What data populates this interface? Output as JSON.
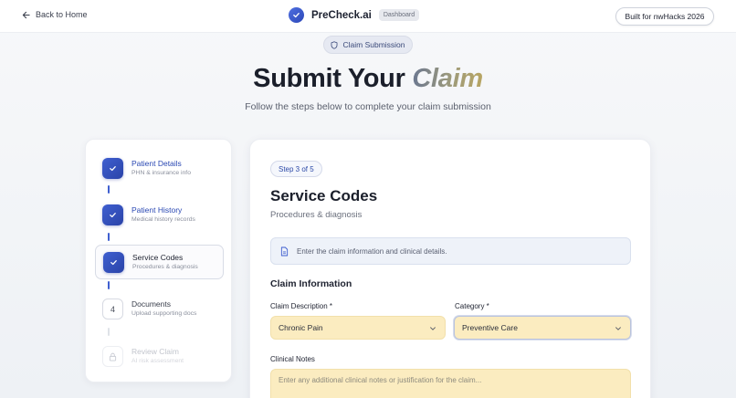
{
  "nav": {
    "back_label": "Back to Home",
    "brand_name": "PreCheck.ai",
    "brand_badge": "Dashboard",
    "built_label": "Built for nwHacks 2026"
  },
  "hero": {
    "pill_label": "Claim Submission",
    "title_main": "Submit Your ",
    "title_accent": "Claim",
    "subtitle": "Follow the steps below to complete your claim submission"
  },
  "steps": [
    {
      "title": "Patient Details",
      "desc": "PHN & insurance info",
      "status": "done"
    },
    {
      "title": "Patient History",
      "desc": "Medical history records",
      "status": "done"
    },
    {
      "title": "Service Codes",
      "desc": "Procedures & diagnosis",
      "status": "active"
    },
    {
      "title": "Documents",
      "desc": "Upload supporting docs",
      "status": "pending",
      "number": "4"
    },
    {
      "title": "Review Claim",
      "desc": "AI risk assessment",
      "status": "locked"
    }
  ],
  "form": {
    "step_indicator": "Step 3 of 5",
    "title": "Service Codes",
    "subtitle": "Procedures & diagnosis",
    "info_text": "Enter the claim information and clinical details.",
    "section_title": "Claim Information",
    "claim_description_label": "Claim Description *",
    "claim_description_value": "Chronic Pain",
    "category_label": "Category *",
    "category_value": "Preventive Care",
    "clinical_notes_label": "Clinical Notes",
    "clinical_notes_placeholder": "Enter any additional clinical notes or justification for the claim..."
  },
  "colors": {
    "accent": "#3f5fd0",
    "field_fill": "#fbecc0",
    "info_fill": "#eef2f9"
  }
}
